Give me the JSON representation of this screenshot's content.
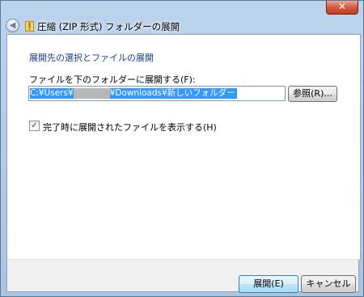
{
  "window": {
    "title": "圧縮 (ZIP 形式) フォルダーの展開",
    "close_label": "✕",
    "back_label": "◀"
  },
  "main": {
    "heading": "展開先の選択とファイルの展開",
    "path_label": "ファイルを下のフォルダーに展開する(F):",
    "path_value_prefix": "C:¥Users¥",
    "path_value_suffix": "¥Downloads¥新しいフォルダー",
    "browse_label": "参照(R)...",
    "show_files_label": "完了時に展開されたファイルを表示する(H)",
    "show_files_checked": true,
    "check_glyph": "✓"
  },
  "footer": {
    "extract_label": "展開(E)",
    "cancel_label": "キャンセル"
  },
  "colors": {
    "accent": "#1c3d86",
    "selection": "#3399ff",
    "frame": "#bcd3ec",
    "close": "#c63b22"
  }
}
